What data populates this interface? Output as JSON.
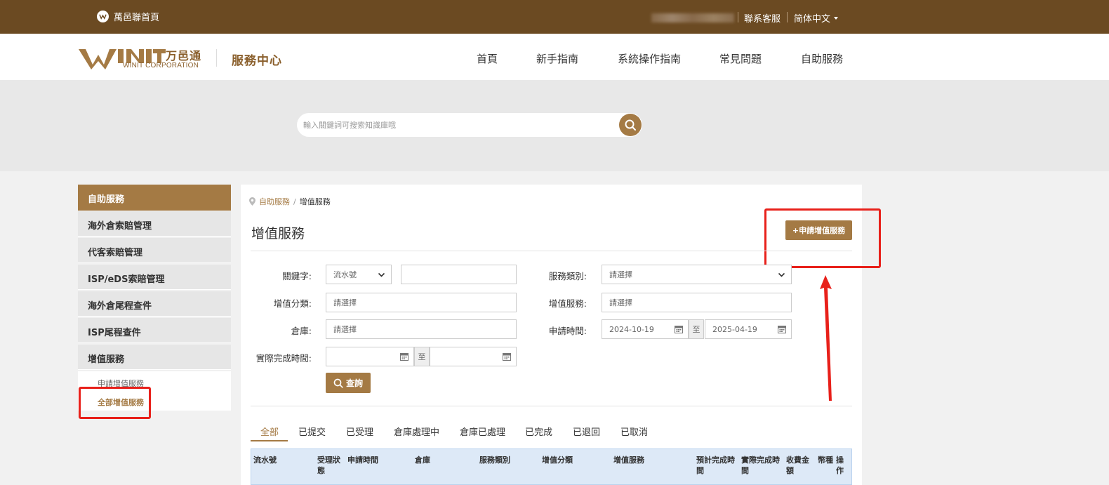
{
  "topbar": {
    "home_label": "萬邑聯首頁",
    "contact_label": "聯系客服",
    "language_label": "简体中文"
  },
  "header": {
    "brand_sub": "WINIT CORPORATION",
    "brand_cn": "万邑通",
    "service_center": "服務中心",
    "nav": [
      "首頁",
      "新手指南",
      "系統操作指南",
      "常見問題",
      "自助服務"
    ]
  },
  "search": {
    "placeholder": "輸入關鍵詞可搜索知識庫哦"
  },
  "sidebar": {
    "title": "自助服務",
    "items": [
      "海外倉索賠管理",
      "代客索賠管理",
      "ISP/eDS索賠管理",
      "海外倉尾程查件",
      "ISP尾程查件",
      "增值服務"
    ],
    "sub_items": [
      "申請增值服務",
      "全部增值服務"
    ],
    "active_sub": "全部增值服務"
  },
  "breadcrumb": {
    "parent": "自助服務",
    "separator": "/",
    "current": "增值服務"
  },
  "page": {
    "title": "增值服務",
    "apply_button": "+申請增值服務"
  },
  "filters": {
    "keyword_label": "關鍵字:",
    "keyword_type": "流水號",
    "keyword_value": "",
    "service_category_label": "服務類別:",
    "service_category_value": "請選擇",
    "va_category_label": "增值分類:",
    "va_category_value": "請選擇",
    "va_service_label": "增值服務:",
    "va_service_value": "請選擇",
    "warehouse_label": "倉庫:",
    "warehouse_value": "請選擇",
    "apply_time_label": "申請時間:",
    "apply_time_from": "2024-10-19",
    "apply_time_to": "2025-04-19",
    "range_sep": "至",
    "actual_done_label": "實際完成時間:",
    "actual_done_from": "",
    "actual_done_to": "",
    "query_button": "查詢"
  },
  "tabs": [
    "全部",
    "已提交",
    "已受理",
    "倉庫處理中",
    "倉庫已處理",
    "已完成",
    "已退回",
    "已取消"
  ],
  "table": {
    "columns": [
      "流水號",
      "受理狀態",
      "申請時間",
      "倉庫",
      "服務類別",
      "增值分類",
      "增值服務",
      "預計完成時間",
      "實際完成時間",
      "收費金額",
      "幣種",
      "操作"
    ]
  },
  "colors": {
    "topbar": "#6b4a22",
    "accent": "#a47a44",
    "annotation": "#e8201a"
  }
}
